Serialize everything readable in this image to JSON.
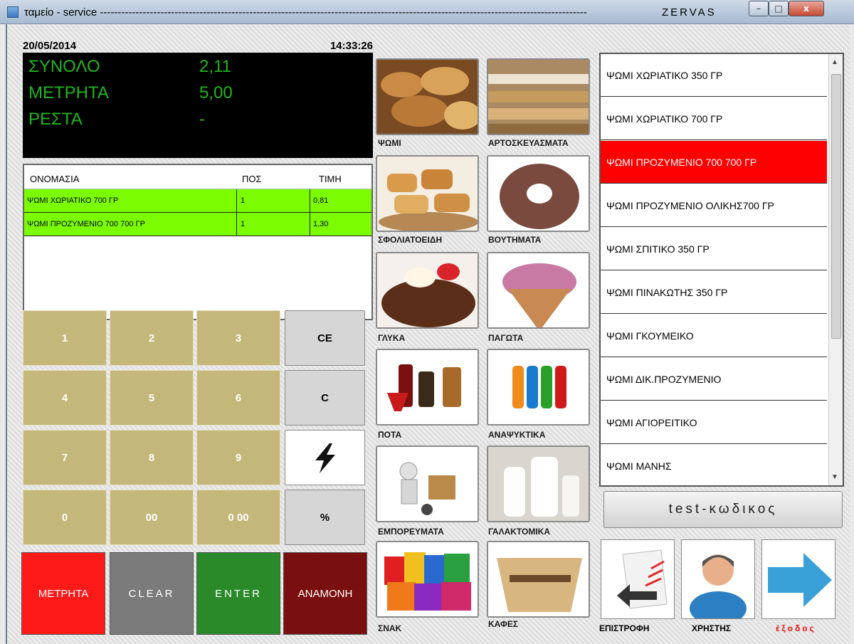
{
  "window": {
    "title": "ταμείο - service",
    "dashes": "-----------------------------------------------------------------------------------------------------------------------------------------",
    "brand": "ZERVAS",
    "min": "–",
    "max": "□",
    "close": "x"
  },
  "display": {
    "date": "20/05/2014",
    "time": "14:33:26",
    "total_label": "ΣΥΝΟΛΟ",
    "total_value": "2,11",
    "cash_label": "ΜΕΤΡΗΤΑ",
    "cash_value": "5,00",
    "change_label": "ΡΕΣΤΑ",
    "change_value": "-"
  },
  "receipt": {
    "headers": [
      "ΟΝΟΜΑΣΙΑ",
      "ΠΟΣ",
      "ΤΙΜΗ"
    ],
    "rows": [
      {
        "name": "ΨΩΜΙ ΧΩΡΙΑΤΙΚΟ 700 ΓΡ",
        "qty": "1",
        "price": "0,81"
      },
      {
        "name": "ΨΩΜΙ ΠΡΟΖΥΜΕΝΙΟ 700 700 ΓΡ",
        "qty": "1",
        "price": "1,30"
      }
    ]
  },
  "keypad": {
    "keys": [
      "1",
      "2",
      "3",
      "4",
      "5",
      "6",
      "7",
      "8",
      "9",
      "0",
      "00",
      "0 00"
    ],
    "ce": "CE",
    "c": "C",
    "percent": "%",
    "cash": "ΜΕΤΡΗΤΑ",
    "clear": "CLEAR",
    "enter": "ENTER",
    "hold": "ΑΝΑΜΟΝΗ"
  },
  "categories": [
    {
      "label": "ΨΩΜΙ",
      "icon": "bread-icon"
    },
    {
      "label": "ΑΡΤΟΣΚΕΥΑΣΜΑΤΑ",
      "icon": "bakery-icon"
    },
    {
      "label": "ΣΦΟΛΙΑΤΟΕΙΔΗ",
      "icon": "pastry-icon"
    },
    {
      "label": "ΒΟΥΤΗΜΑΤΑ",
      "icon": "donut-icon"
    },
    {
      "label": "ΓΛΥΚΑ",
      "icon": "dessert-icon"
    },
    {
      "label": "ΠΑΓΩΤΑ",
      "icon": "ice-cream-icon"
    },
    {
      "label": "ΠΟΤΑ",
      "icon": "drinks-icon"
    },
    {
      "label": "ΑΝΑΨΥΚΤΙΚΑ",
      "icon": "soft-drinks-icon"
    },
    {
      "label": "ΕΜΠΟΡΕΥΜΑΤΑ",
      "icon": "goods-icon"
    },
    {
      "label": "ΓΑΛΑΚΤΟΜΙΚΑ",
      "icon": "milk-icon"
    },
    {
      "label": "ΣΝΑΚ",
      "icon": "snacks-icon"
    },
    {
      "label": "ΚΑΦΕΣ",
      "icon": "coffee-icon"
    }
  ],
  "products": [
    "ΨΩΜΙ ΧΩΡΙΑΤΙΚΟ 350 ΓΡ",
    "ΨΩΜΙ ΧΩΡΙΑΤΙΚΟ 700 ΓΡ",
    "ΨΩΜΙ ΠΡΟΖΥΜΕΝΙΟ 700 700 ΓΡ",
    "ΨΩΜΙ ΠΡΟΖΥΜΕΝΙΟ ΟΛΙΚΗΣ700 ΓΡ",
    "ΨΩΜΙ ΣΠΙΤΙΚΟ 350 ΓΡ",
    "ΨΩΜΙ ΠΙΝΑΚΩΤΗΣ 350 ΓΡ",
    "ΨΩΜΙ ΓΚΟΥΜΕΙΚΟ",
    "ΨΩΜΙ ΔΙΚ.ΠΡΟΖΥΜΕΝΙΟ",
    "ΨΩΜΙ ΑΓΙΟΡΕΙΤΙΚΟ",
    "ΨΩΜΙ ΜΑΝΗΣ"
  ],
  "selected_product_index": 2,
  "test_code": "test-κωδικος",
  "actions": {
    "return": "ΕΠΙΣΤΡΟΦΗ",
    "user": "ΧΡΗΣΤΗΣ",
    "exit": "έξοδος"
  },
  "colors": {
    "lcd_text": "#1fb51f",
    "receipt_row": "#7cfc00",
    "selected_product": "#ff0000",
    "keypad": "#c4b77a",
    "cash_button": "#ff1a1a",
    "clear_button": "#7b7b7b",
    "enter_button": "#2a8a2a",
    "hold_button": "#7a0f0f",
    "exit_text": "#e81010"
  }
}
